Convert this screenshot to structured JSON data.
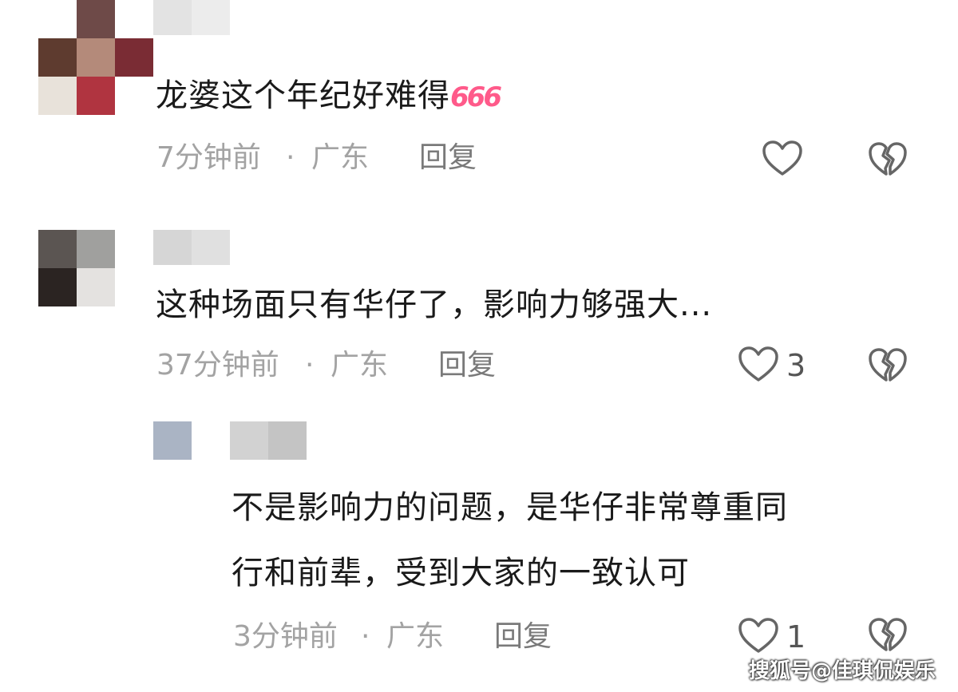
{
  "comments": [
    {
      "text": "龙婆这个年纪好难得",
      "emoji": "666",
      "time": "7分钟前",
      "dot": "·",
      "location": "广东",
      "reply_label": "回复",
      "likes": ""
    },
    {
      "text": "这种场面只有华仔了，影响力够强大...",
      "time": "37分钟前",
      "dot": "·",
      "location": "广东",
      "reply_label": "回复",
      "likes": "3"
    },
    {
      "text_line1": "不是影响力的问题，是华仔非常尊重同",
      "text_line2": "行和前辈，受到大家的一致认可",
      "time": "3分钟前",
      "dot": "·",
      "location": "广东",
      "reply_label": "回复",
      "likes": "1"
    }
  ],
  "colors": {
    "emoji": "#ff5a8a",
    "icon": "#666666",
    "meta": "#a3a3a3",
    "text": "#1a1a1a"
  },
  "icons": [
    "heart-outline-icon",
    "broken-heart-icon"
  ],
  "watermark": "搜狐号@佳琪侃娱乐"
}
